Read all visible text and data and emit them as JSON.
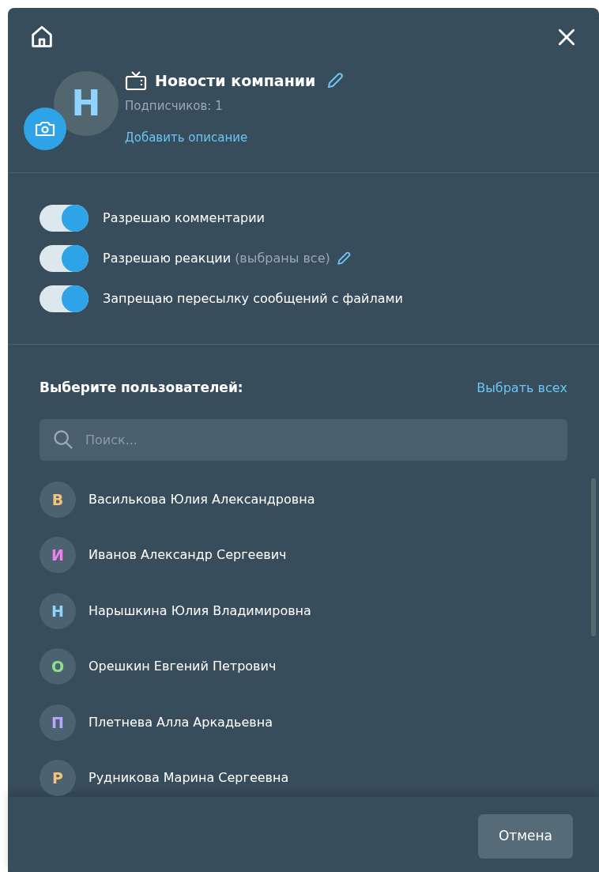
{
  "channel": {
    "avatar_letter": "Н",
    "name": "Новости компании",
    "subscribers": "Подписчиков: 1",
    "add_description": "Добавить описание"
  },
  "settings": [
    {
      "label": "Разрешаю комментарии",
      "editable": false,
      "on": true
    },
    {
      "label": "Разрешаю реакции",
      "note": "(выбраны все)",
      "editable": true,
      "on": true
    },
    {
      "label": "Запрещаю пересылку сообщений с файлами",
      "editable": false,
      "on": true
    }
  ],
  "users_section": {
    "title": "Выберите пользователей:",
    "select_all": "Выбрать всех",
    "search_placeholder": "Поиск..."
  },
  "users": [
    {
      "initial": "В",
      "name": "Василькова Юлия Александровна",
      "color": "#f5c27a"
    },
    {
      "initial": "И",
      "name": "Иванов Александр Сергеевич",
      "color": "#f07ef0"
    },
    {
      "initial": "Н",
      "name": "Нарышкина Юлия Владимировна",
      "color": "#8fd3ff"
    },
    {
      "initial": "О",
      "name": "Орешкин Евгений Петрович",
      "color": "#8ee08e"
    },
    {
      "initial": "П",
      "name": "Плетнева Алла Аркадьевна",
      "color": "#b9a6ff"
    },
    {
      "initial": "Р",
      "name": "Рудникова Марина Сергеевна",
      "color": "#f5c27a"
    }
  ],
  "footer": {
    "cancel": "Отмена"
  }
}
